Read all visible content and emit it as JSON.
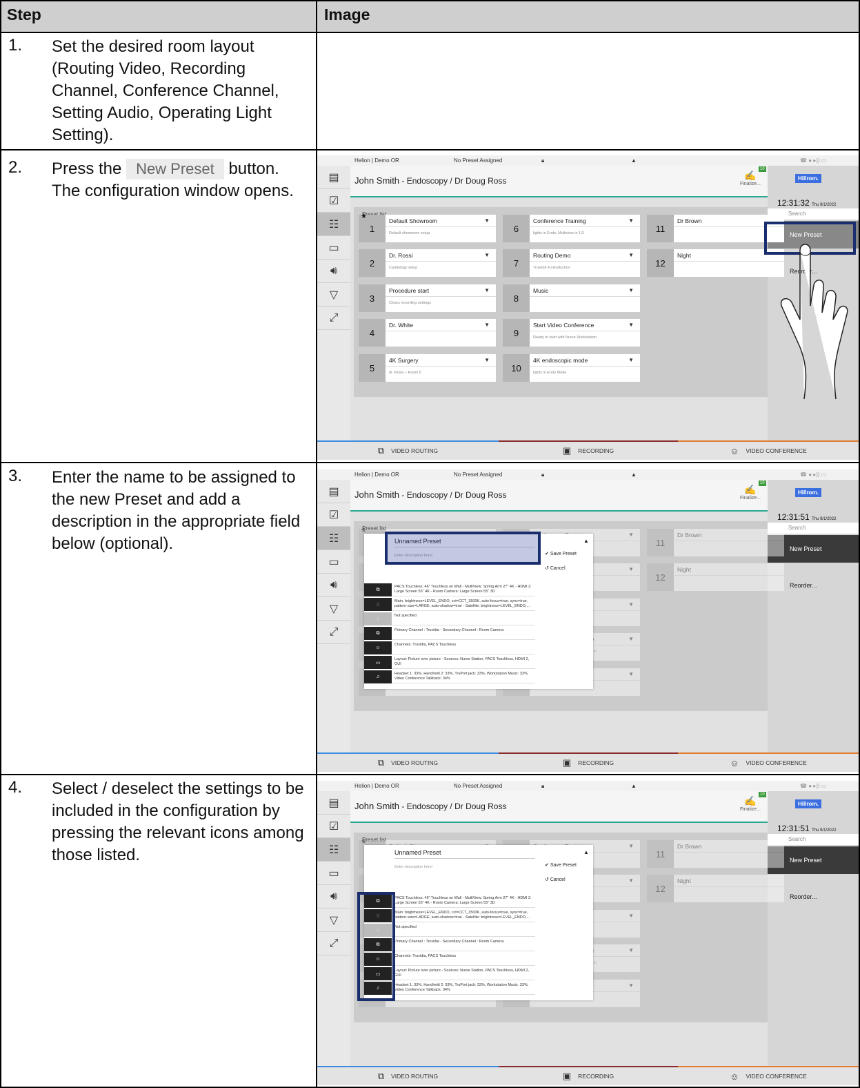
{
  "table": {
    "header_step": "Step",
    "header_image": "Image"
  },
  "steps": [
    {
      "num": "1.",
      "text": "Set the desired room layout (Routing Video, Recording Channel, Conference Channel, Setting Audio, Operating Light Setting)."
    },
    {
      "num": "2.",
      "text_before": "Press the",
      "button": "New Preset",
      "text_after": "button. The configuration window opens."
    },
    {
      "num": "3.",
      "text": "Enter the name to be assigned to the new Preset and add a description in the appropriate field below (optional)."
    },
    {
      "num": "4.",
      "text": "Select / deselect the settings to be included in the configuration by pressing the relevant icons among those listed."
    }
  ],
  "ui": {
    "room": "Helion | Demo OR",
    "preset_status": "No Preset Assigned",
    "patient": "John Smith",
    "patient_sub": "- Endoscopy / Dr Doug Ross",
    "finalize": "Finalize...",
    "badge": "10",
    "brand": "Hillrom.",
    "times": [
      "12:31:32",
      "12:31:51",
      "12:31:51"
    ],
    "date": "Thu 9/1/2022",
    "search": "Search",
    "new_preset": "New Preset",
    "reorder": "Reorder...",
    "preset_list": "Preset list",
    "tabs": [
      "VIDEO ROUTING",
      "RECORDING",
      "VIDEO CONFERENCE"
    ],
    "presets": [
      {
        "n": "1",
        "name": "Default Showroom",
        "desc": "Default showroom setup"
      },
      {
        "n": "2",
        "name": "Dr. Rossi",
        "desc": "Cardiology setup"
      },
      {
        "n": "3",
        "name": "Procedure start",
        "desc": "Clears recording settings"
      },
      {
        "n": "4",
        "name": "Dr. White",
        "desc": ""
      },
      {
        "n": "5",
        "name": "4K Surgery",
        "desc": "dr. Rossi – Room 5"
      },
      {
        "n": "6",
        "name": "Conference Training",
        "desc": "lights in Endo, Multiview in 1\\3"
      },
      {
        "n": "7",
        "name": "Routing Demo",
        "desc": "Truelink 4 introduction"
      },
      {
        "n": "8",
        "name": "Music",
        "desc": ""
      },
      {
        "n": "9",
        "name": "Start Video Conference",
        "desc": "Ready to start with Nurse Workstation"
      },
      {
        "n": "10",
        "name": "4K endoscopic mode",
        "desc": "lights in Endo Mode"
      },
      {
        "n": "11",
        "name": "Dr Brown",
        "desc": ""
      },
      {
        "n": "12",
        "name": "Night",
        "desc": ""
      }
    ],
    "popup": {
      "title": "Unnamed Preset",
      "desc_placeholder": "Enter description here!",
      "save": "Save Preset",
      "cancel": "Cancel",
      "rows": [
        "PACS Touchless: 46\" Touchless on Wall - MultiView: Spring Arm 27\" 4K - HDMI 2: Large Screen 55\" 4K - Room Camera: Large Screen 55\" 3D",
        "Main: brightness=LEVEL_ENDO, cct=CCT_3500K, auto-focus=true, sync=true, pattern-size=LARGE, auto-shadow=true - Satellite: brightness=LEVEL_ENDO,...",
        "Not specified",
        "Primary Channel : Truvidia - Secondary Channel : Room Camera",
        "Channels: Truvidia, PACS Touchless",
        "Layout: Picture over picture - Sources: Nurse Station, PACS Touchless, HDMI 2, GUI",
        "Headset 1: 33%, Handheld 2: 33%, TruPort jack: 33%, Workstation Music: 33%, Video Conference Talkback: 34%"
      ]
    }
  }
}
